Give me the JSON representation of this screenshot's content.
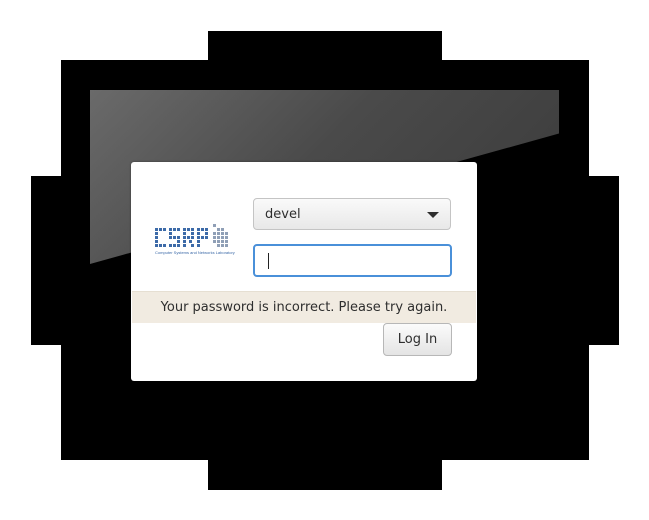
{
  "login": {
    "selected_user": "devel",
    "password_value": "",
    "error_message": "Your password is incorrect. Please try again.",
    "login_button_label": "Log In"
  },
  "logo": {
    "name": "CSRP",
    "tagline": "Computer Systems and Networks Laboratory",
    "color": "#3c6aa8"
  },
  "icons": {
    "dropdown": "chevron-down-icon"
  },
  "colors": {
    "focus_border": "#4a90d9",
    "error_background": "#f1ebe1",
    "backdrop": "#000000"
  }
}
